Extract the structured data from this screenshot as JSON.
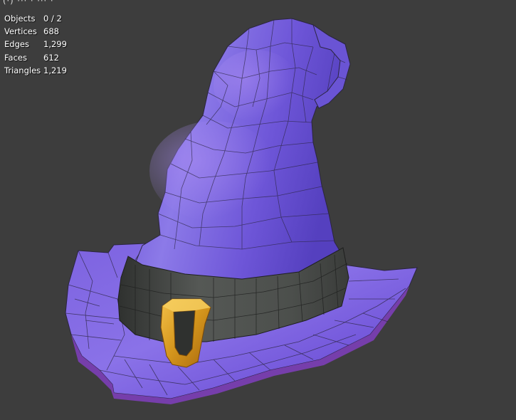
{
  "viewport": {
    "background": "#3d3d3d",
    "overlay_clipped_text": "(·) ··· · ··· ·"
  },
  "stats": [
    {
      "label": "Objects",
      "value": "0 / 2"
    },
    {
      "label": "Vertices",
      "value": "688"
    },
    {
      "label": "Edges",
      "value": "1,299"
    },
    {
      "label": "Faces",
      "value": "612"
    },
    {
      "label": "Triangles",
      "value": "1,219"
    }
  ],
  "model": {
    "name": "witch-hat",
    "colors": {
      "hat_light": "#8f78e6",
      "hat_mid": "#6e52d6",
      "hat_dark": "#4a2fa8",
      "band": "#4f524f",
      "band_dark": "#363836",
      "buckle": "#e0a62a",
      "buckle_dark": "#9a6410",
      "wire": "#2b2540"
    }
  }
}
